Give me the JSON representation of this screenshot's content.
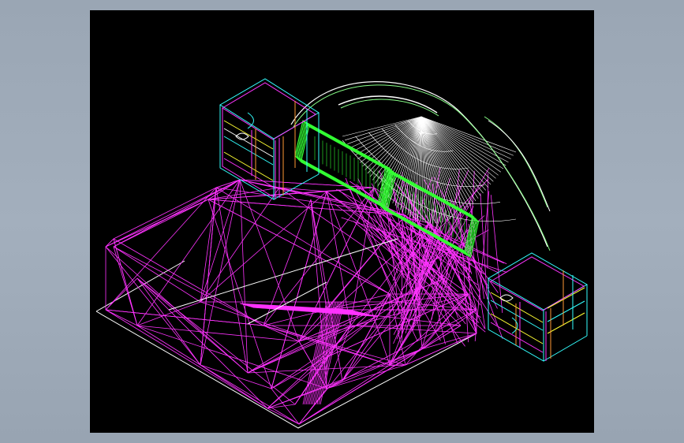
{
  "window": {
    "background_color": "#9ea9b7"
  },
  "drawing": {
    "background_color": "#000000",
    "subject": "isometric-bed-wireframe",
    "colors": {
      "mattress": "#ff33ff",
      "headboard": "#33ff33",
      "fan": "#ffffff",
      "nightstand_cyan": "#33ffff",
      "nightstand_orange": "#ff9933",
      "nightstand_yellow": "#ffff33",
      "outline": "#ffffff"
    }
  }
}
